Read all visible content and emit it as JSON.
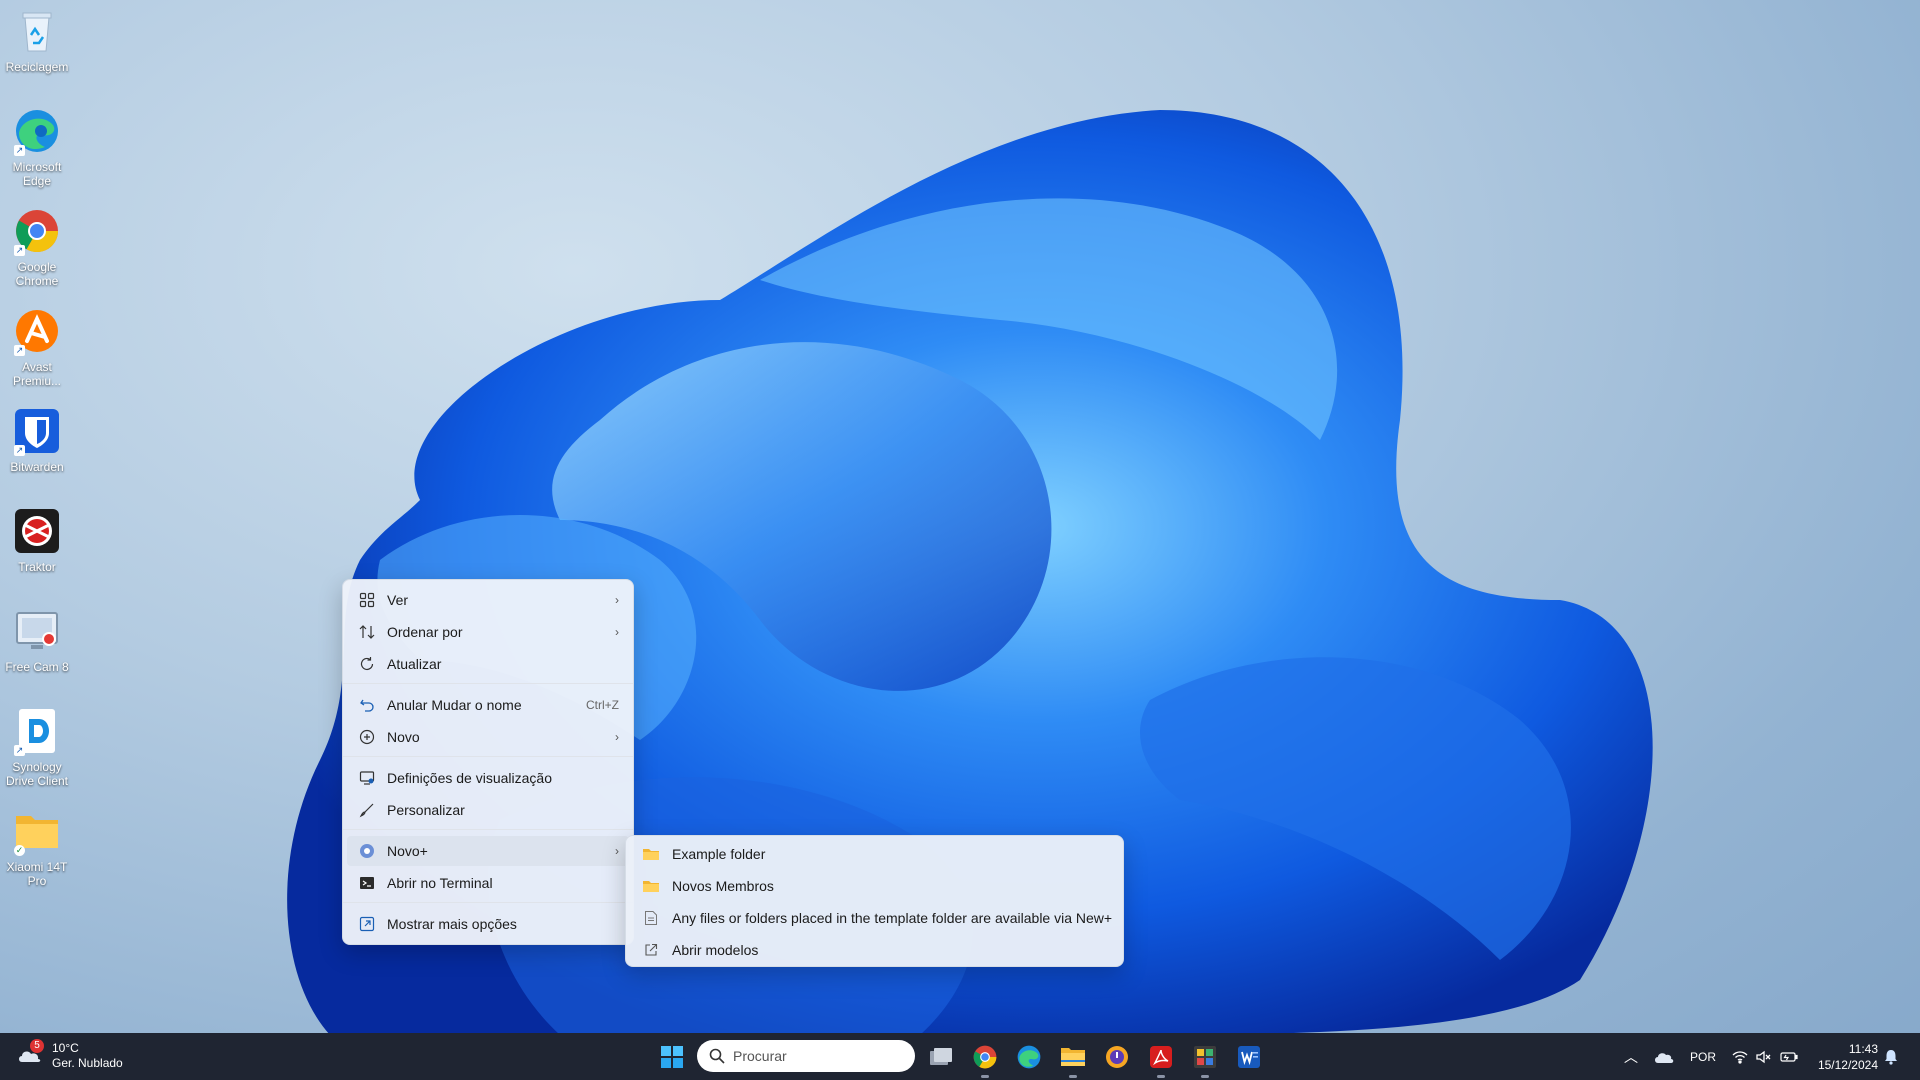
{
  "desktop": {
    "icons": [
      {
        "label": "Reciclagem"
      },
      {
        "label": "Microsoft Edge"
      },
      {
        "label": "Google Chrome"
      },
      {
        "label": "Avast Premiu..."
      },
      {
        "label": "Bitwarden"
      },
      {
        "label": "Traktor"
      },
      {
        "label": "Free Cam 8"
      },
      {
        "label": "Synology Drive Client"
      },
      {
        "label": "Xiaomi 14T Pro"
      }
    ]
  },
  "context_menu": {
    "items": [
      {
        "label": "Ver",
        "icon": "grid-icon",
        "submenu": true
      },
      {
        "label": "Ordenar por",
        "icon": "sort-icon",
        "submenu": true
      },
      {
        "label": "Atualizar",
        "icon": "refresh-icon"
      },
      {
        "label": "Anular Mudar o nome",
        "icon": "undo-icon",
        "shortcut": "Ctrl+Z"
      },
      {
        "label": "Novo",
        "icon": "plus-circle-icon",
        "submenu": true
      },
      {
        "label": "Definições de visualização",
        "icon": "display-settings-icon"
      },
      {
        "label": "Personalizar",
        "icon": "brush-icon"
      },
      {
        "label": "Novo+",
        "icon": "new-plus-icon",
        "submenu": true
      },
      {
        "label": "Abrir no Terminal",
        "icon": "terminal-icon"
      },
      {
        "label": "Mostrar mais opções",
        "icon": "more-options-icon"
      }
    ]
  },
  "submenu": {
    "items": [
      {
        "label": "Example folder",
        "icon": "folder-icon"
      },
      {
        "label": "Novos Membros",
        "icon": "folder-icon"
      },
      {
        "label": "Any files or folders placed in the template folder are available via New+",
        "icon": "document-icon"
      },
      {
        "label": "Abrir modelos",
        "icon": "open-external-icon"
      }
    ]
  },
  "taskbar": {
    "weather": {
      "temp": "10°C",
      "desc": "Ger. Nublado",
      "badge": "5"
    },
    "search_placeholder": "Procurar",
    "language": "POR",
    "time": "11:43",
    "date": "15/12/2024"
  },
  "colors": {
    "accent": "#0a5bd6",
    "taskbar": "#1f2532"
  }
}
